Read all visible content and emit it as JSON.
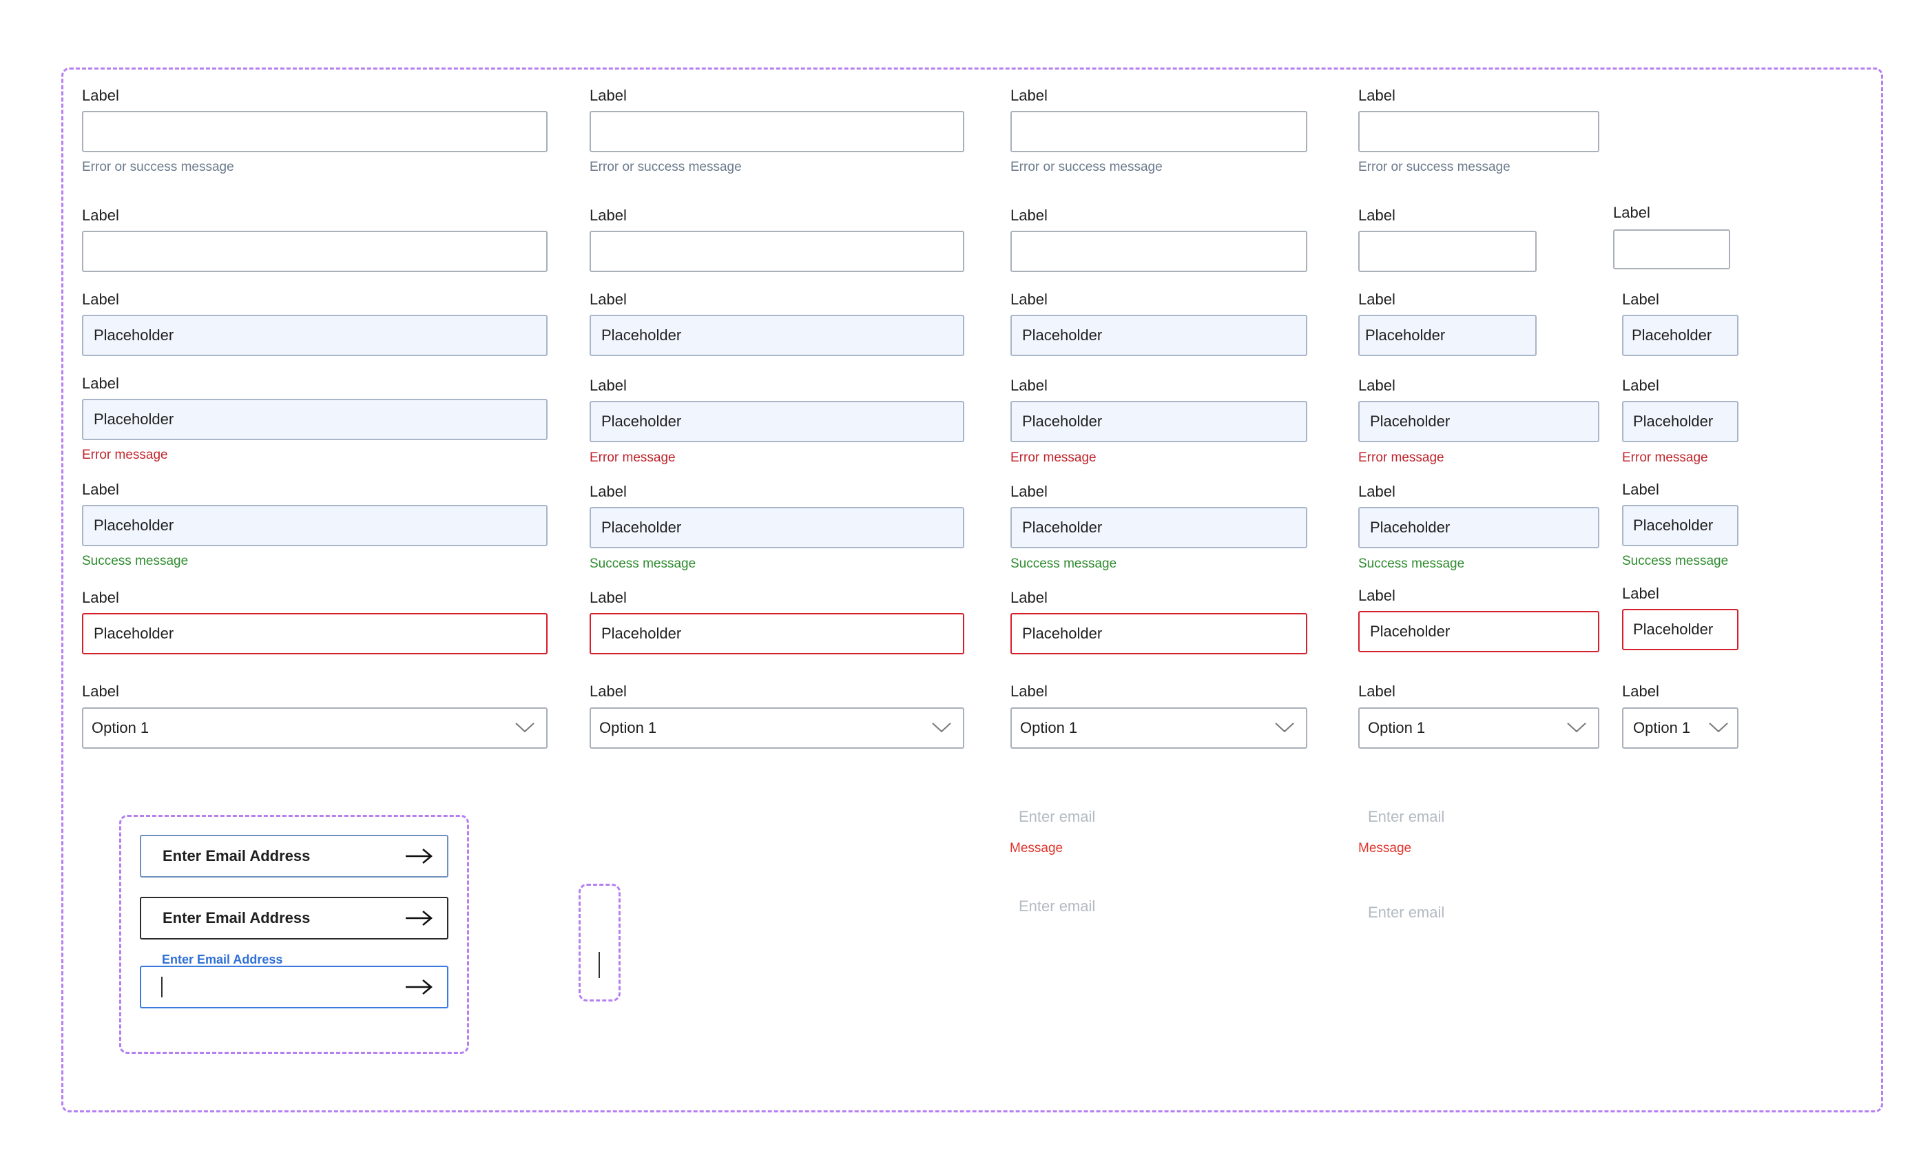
{
  "label": "Label",
  "placeholder": "Placeholder",
  "help_message": "Error or success message",
  "error_message": "Error message",
  "success_message": "Success message",
  "select_value": "Option 1",
  "email_button_label": "Enter Email Address",
  "float_label": "Enter Email Address",
  "ghost_placeholder": "Enter email",
  "red_message": "Message",
  "colors": {
    "frame_dash": "#b57ff0",
    "border_default": "#a9b0ba",
    "filled_bg": "#f1f5fd",
    "error_red": "#d4202c",
    "success_green": "#2e8b2e",
    "focus_blue": "#3b7be0"
  },
  "icons": {
    "select": "chevron-down-icon",
    "email": "arrow-right-icon"
  }
}
